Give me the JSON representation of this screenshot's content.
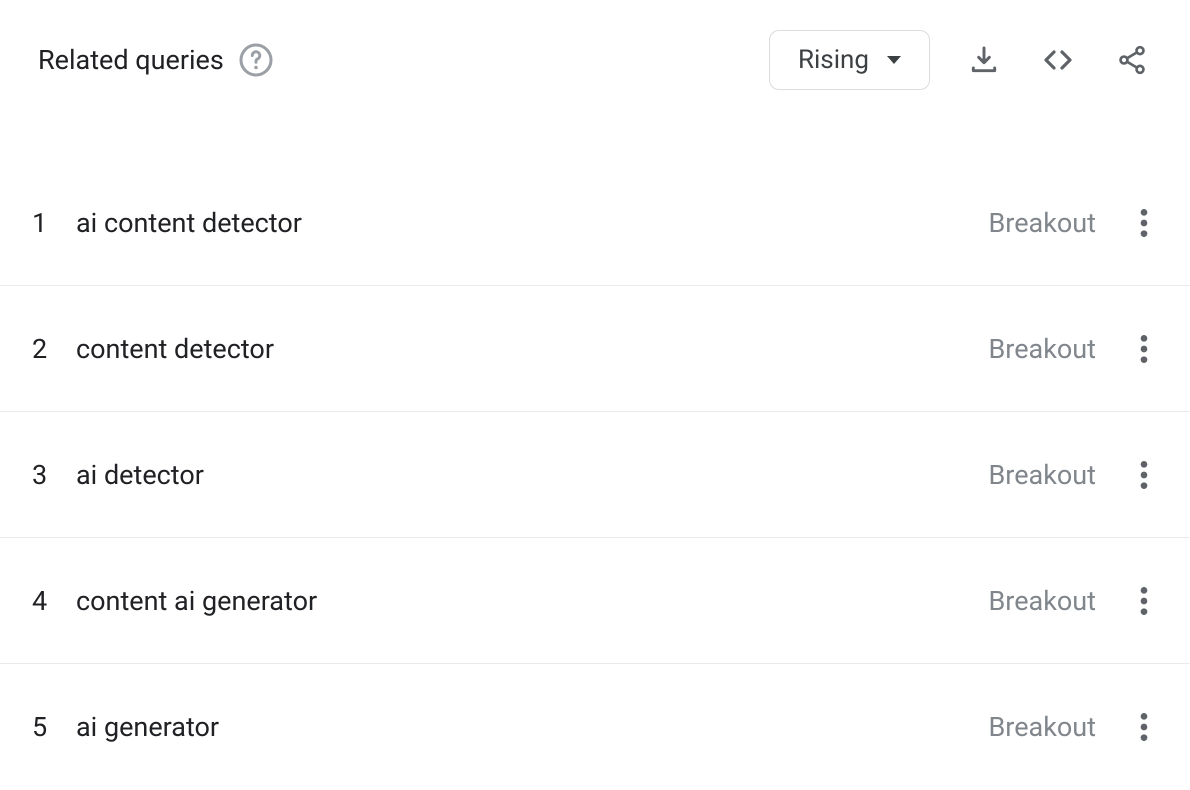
{
  "header": {
    "title": "Related queries",
    "dropdown_label": "Rising"
  },
  "queries": [
    {
      "rank": "1",
      "label": "ai content detector",
      "value": "Breakout"
    },
    {
      "rank": "2",
      "label": "content detector",
      "value": "Breakout"
    },
    {
      "rank": "3",
      "label": "ai detector",
      "value": "Breakout"
    },
    {
      "rank": "4",
      "label": "content ai generator",
      "value": "Breakout"
    },
    {
      "rank": "5",
      "label": "ai generator",
      "value": "Breakout"
    }
  ]
}
